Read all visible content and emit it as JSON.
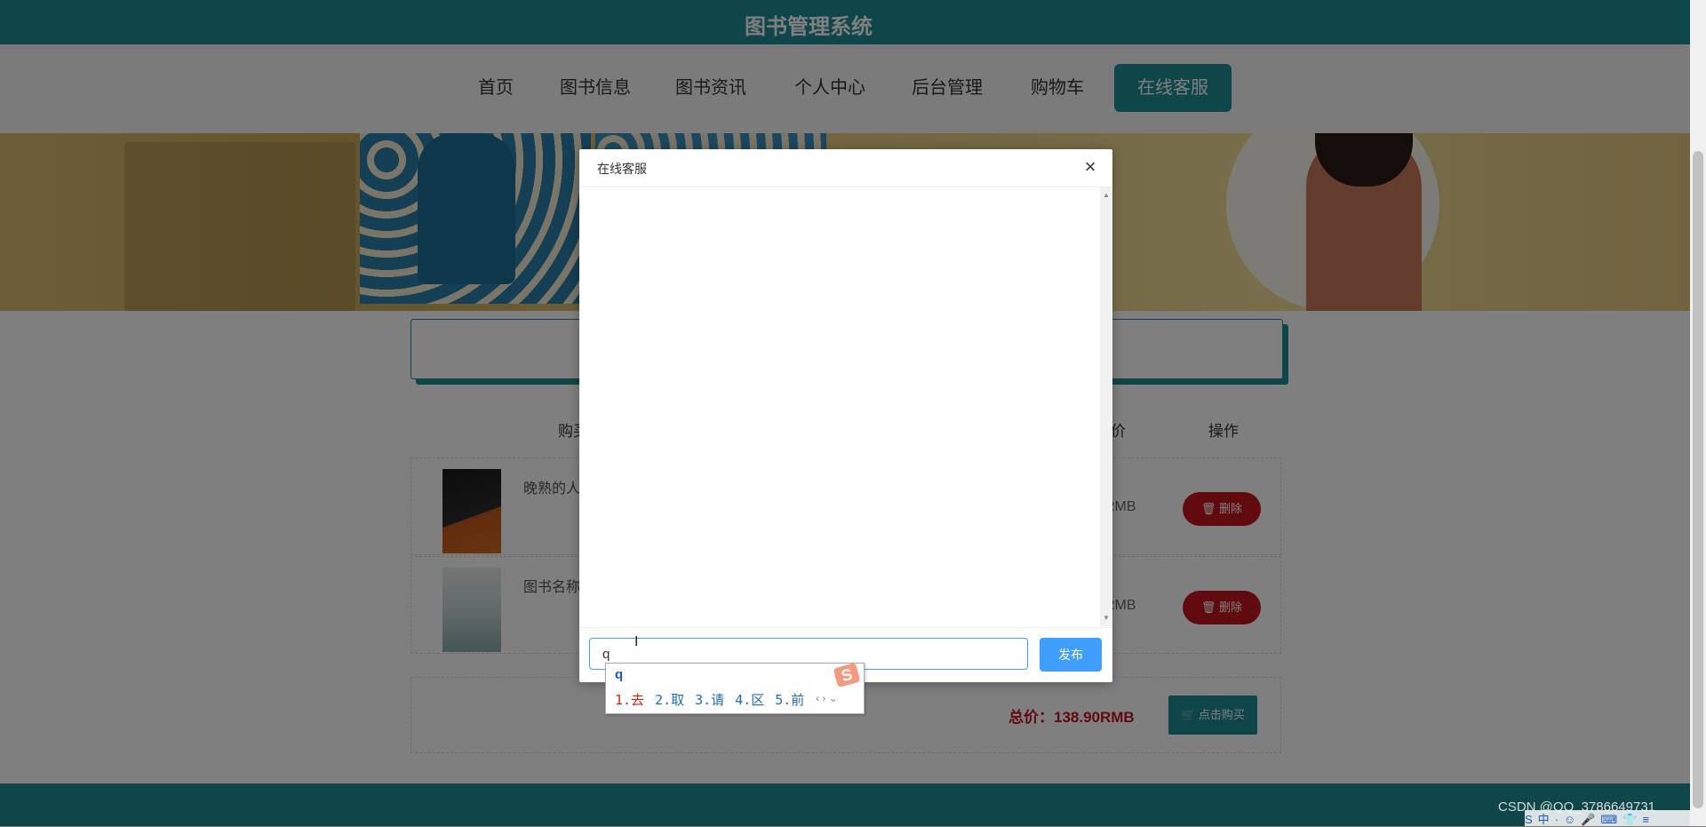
{
  "site": {
    "title": "图书管理系统"
  },
  "nav": {
    "items": [
      {
        "label": "首页"
      },
      {
        "label": "图书信息"
      },
      {
        "label": "图书资讯"
      },
      {
        "label": "个人中心"
      },
      {
        "label": "后台管理"
      },
      {
        "label": "购物车"
      },
      {
        "label": "在线客服",
        "active": true
      }
    ]
  },
  "cart": {
    "headers": {
      "buy": "购买",
      "price": "价",
      "action": "操作"
    },
    "items": [
      {
        "name": "晚熟的人",
        "price": "RMB",
        "delete_label": "删除"
      },
      {
        "name": "图书名称",
        "price": "RMB",
        "delete_label": "删除"
      }
    ],
    "total_label": "总价：138.90RMB",
    "buy_label": "点击购买"
  },
  "modal": {
    "title": "在线客服",
    "close": "×",
    "input_value": "q",
    "send_label": "发布"
  },
  "ime": {
    "composition": "q",
    "candidates": [
      "1.去",
      "2.取",
      "3.请",
      "4.区",
      "5.前"
    ],
    "arrows": "‹ › ⌄",
    "logo": "S"
  },
  "watermark": "CSDN @QQ_3786649731",
  "tray": {
    "items": [
      "S",
      "中",
      "·",
      "☺",
      "🎤",
      "⌨",
      "👕",
      "≡"
    ]
  },
  "colors": {
    "primary": "#1f8c94",
    "danger": "#c3161c",
    "link_blue": "#409eff"
  }
}
